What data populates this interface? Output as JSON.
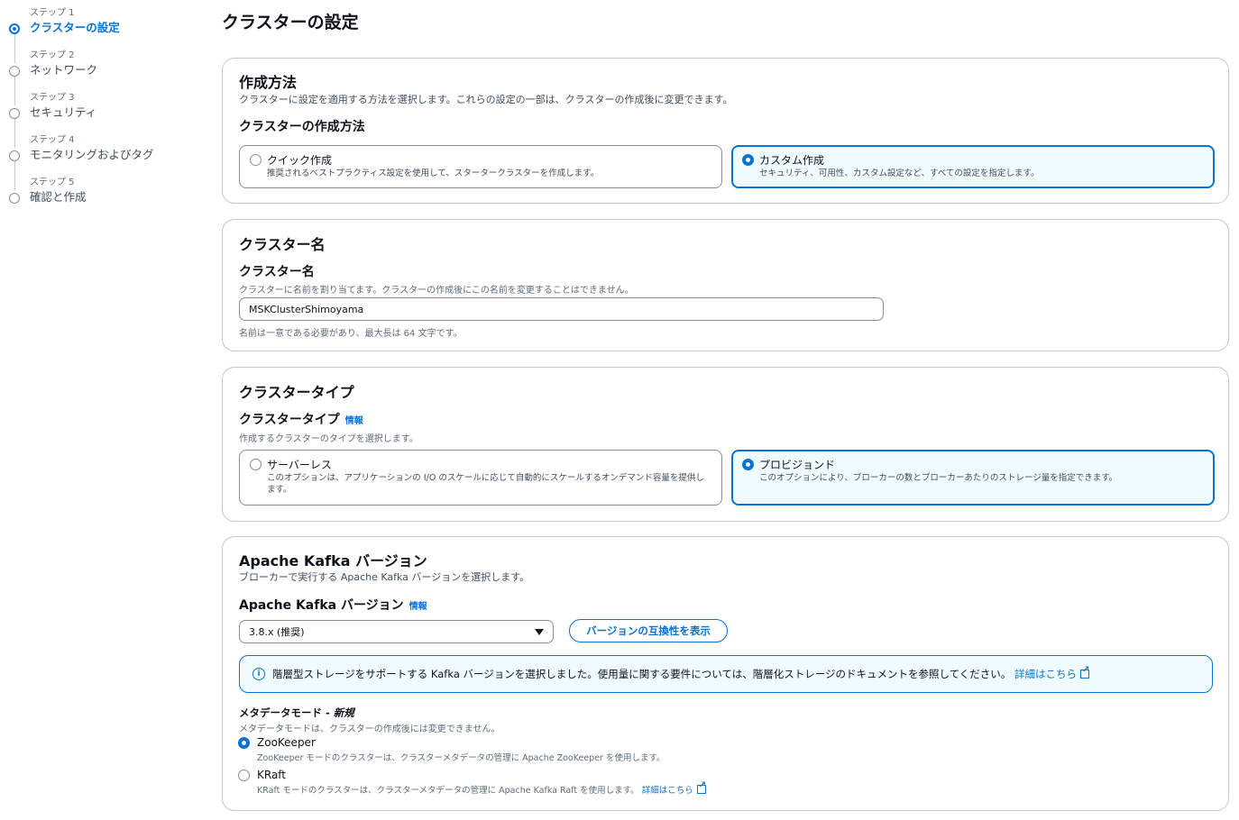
{
  "steps": [
    {
      "num": "ステップ 1",
      "title": "クラスターの設定",
      "active": true
    },
    {
      "num": "ステップ 2",
      "title": "ネットワーク"
    },
    {
      "num": "ステップ 3",
      "title": "セキュリティ"
    },
    {
      "num": "ステップ 4",
      "title": "モニタリングおよびタグ"
    },
    {
      "num": "ステップ 5",
      "title": "確認と作成"
    }
  ],
  "page_title": "クラスターの設定",
  "creation": {
    "header": "作成方法",
    "description": "クラスターに設定を適用する方法を選択します。これらの設定の一部は、クラスターの作成後に変更できます。",
    "label": "クラスターの作成方法",
    "options": [
      {
        "title": "クイック作成",
        "desc": "推奨されるベストプラクティス設定を使用して、スタータークラスターを作成します。",
        "selected": false
      },
      {
        "title": "カスタム作成",
        "desc": "セキュリティ、可用性、カスタム設定など、すべての設定を指定します。",
        "selected": true
      }
    ]
  },
  "cluster_name": {
    "header": "クラスター名",
    "label": "クラスター名",
    "description": "クラスターに名前を割り当てます。クラスターの作成後にこの名前を変更することはできません。",
    "value": "MSKClusterShimoyama",
    "constraint": "名前は一意である必要があり、最大長は 64 文字です。"
  },
  "cluster_type": {
    "header": "クラスタータイプ",
    "label": "クラスタータイプ",
    "info": "情報",
    "description": "作成するクラスターのタイプを選択します。",
    "options": [
      {
        "title": "サーバーレス",
        "desc": "このオプションは、アプリケーションの I/O のスケールに応じて自動的にスケールするオンデマンド容量を提供します。",
        "selected": false
      },
      {
        "title": "プロビジョンド",
        "desc": "このオプションにより、ブローカーの数とブローカーあたりのストレージ量を指定できます。",
        "selected": true
      }
    ]
  },
  "kafka": {
    "header": "Apache Kafka バージョン",
    "description": "ブローカーで実行する Apache Kafka バージョンを選択します。",
    "label": "Apache Kafka バージョン",
    "info": "情報",
    "selected_version": "3.8.x (推奨)",
    "compat_button": "バージョンの互換性を表示",
    "alert_icon": "info-icon",
    "alert_text": "階層型ストレージをサポートする Kafka バージョンを選択しました。使用量に関する要件については、階層化ストレージのドキュメントを参照してください。",
    "alert_link": "詳細はこちら",
    "metadata_label": "メタデータモード - ",
    "metadata_new": "新規",
    "metadata_desc": "メタデータモードは、クラスターの作成後には変更できません。",
    "modes": [
      {
        "title": "ZooKeeper",
        "desc": "ZooKeeper モードのクラスターは、クラスターメタデータの管理に Apache ZooKeeper を使用します。",
        "selected": true
      },
      {
        "title": "KRaft",
        "desc": "KRaft モードのクラスターは、クラスターメタデータの管理に Apache Kafka Raft を使用します。",
        "link": "詳細はこちら",
        "selected": false
      }
    ]
  },
  "colors": {
    "accent": "#0972d3",
    "selected_bg": "#f0fbff",
    "border": "#c6c6cd"
  }
}
